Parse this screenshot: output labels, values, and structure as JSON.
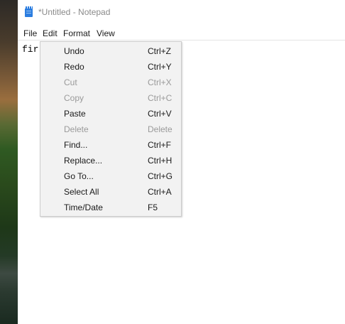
{
  "window": {
    "title": "*Untitled - Notepad"
  },
  "menubar": {
    "items": [
      "File",
      "Edit",
      "Format",
      "View"
    ]
  },
  "editor": {
    "text": "fir"
  },
  "context_menu": {
    "items": [
      {
        "label": "Undo",
        "shortcut": "Ctrl+Z",
        "enabled": true
      },
      {
        "label": "Redo",
        "shortcut": "Ctrl+Y",
        "enabled": true
      },
      {
        "label": "Cut",
        "shortcut": "Ctrl+X",
        "enabled": false
      },
      {
        "label": "Copy",
        "shortcut": "Ctrl+C",
        "enabled": false
      },
      {
        "label": "Paste",
        "shortcut": "Ctrl+V",
        "enabled": true
      },
      {
        "label": "Delete",
        "shortcut": "Delete",
        "enabled": false
      },
      {
        "label": "Find...",
        "shortcut": "Ctrl+F",
        "enabled": true
      },
      {
        "label": "Replace...",
        "shortcut": "Ctrl+H",
        "enabled": true
      },
      {
        "label": "Go To...",
        "shortcut": "Ctrl+G",
        "enabled": true
      },
      {
        "label": "Select All",
        "shortcut": "Ctrl+A",
        "enabled": true
      },
      {
        "label": "Time/Date",
        "shortcut": "F5",
        "enabled": true
      }
    ]
  },
  "colors": {
    "app_icon": "#2b7de0",
    "disabled_text": "#9a9a9a",
    "menu_background": "#f2f2f2"
  },
  "icons": {
    "app_icon": "notepad-icon"
  }
}
